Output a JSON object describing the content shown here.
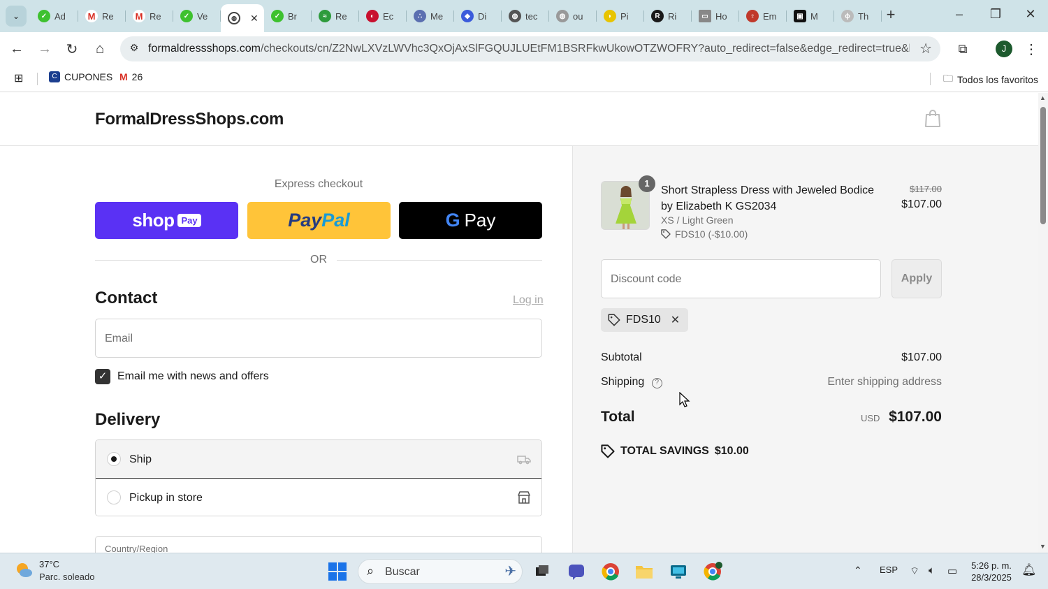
{
  "browser": {
    "tabs": [
      {
        "title": "Ad",
        "color": "#3ec12f"
      },
      {
        "title": "Re",
        "color": "#d93025"
      },
      {
        "title": "Re",
        "color": "#d93025"
      },
      {
        "title": "Ve",
        "color": "#3ec12f"
      },
      {
        "title": "",
        "color": "#555555",
        "active": true
      },
      {
        "title": "Br",
        "color": "#3ec12f"
      },
      {
        "title": "Re",
        "color": "#2e9b3c"
      },
      {
        "title": "Ec",
        "color": "#c8102e"
      },
      {
        "title": "Me",
        "color": "#5b6fb0"
      },
      {
        "title": "Di",
        "color": "#3b5bdb"
      },
      {
        "title": "tec",
        "color": "#555555"
      },
      {
        "title": "ou",
        "color": "#888888"
      },
      {
        "title": "Pi",
        "color": "#e8c400"
      },
      {
        "title": "Ri",
        "color": "#1a1a1a"
      },
      {
        "title": "Ho",
        "color": "#888888"
      },
      {
        "title": "Em",
        "color": "#c0392b"
      },
      {
        "title": "M",
        "color": "#111111"
      },
      {
        "title": "Th",
        "color": "#999999"
      }
    ],
    "url_domain": "formaldressshops.com",
    "url_path": "/checkouts/cn/Z2NwLXVzLWVhc3QxOjAxSlFGQUJLUEtFM1BSRFkwUkowOTZWOFRY?auto_redirect=false&edge_redirect=true&locale=e...",
    "bookmarks": {
      "cupones": "CUPONES",
      "gmail": "26",
      "favorites": "Todos los favoritos"
    },
    "profile_initial": "J"
  },
  "shop": {
    "logo": "FormalDressShops.com"
  },
  "checkout": {
    "express_title": "Express checkout",
    "shop_pay": {
      "shop": "shop",
      "pay": "Pay"
    },
    "paypal": {
      "pay": "Pay",
      "pal": "Pal"
    },
    "gpay": {
      "g": "G",
      "pay": "Pay"
    },
    "or": "OR",
    "contact_title": "Contact",
    "login": "Log in",
    "email_placeholder": "Email",
    "news_label": "Email me with news and offers",
    "delivery_title": "Delivery",
    "ship_label": "Ship",
    "pickup_label": "Pickup in store",
    "country_label": "Country/Region"
  },
  "summary": {
    "qty": "1",
    "product_name": "Short Strapless Dress with Jeweled Bodice by Elizabeth K GS2034",
    "variant": "XS / Light Green",
    "discount_line": "FDS10 (-$10.00)",
    "price_old": "$117.00",
    "price_new": "$107.00",
    "discount_placeholder": "Discount code",
    "apply": "Apply",
    "chip_code": "FDS10",
    "subtotal_label": "Subtotal",
    "subtotal_value": "$107.00",
    "shipping_label": "Shipping",
    "shipping_value": "Enter shipping address",
    "total_label": "Total",
    "total_currency": "USD",
    "total_value": "$107.00",
    "savings_label": "TOTAL SAVINGS",
    "savings_value": "$10.00"
  },
  "taskbar": {
    "temp": "37°C",
    "weather": "Parc. soleado",
    "search": "Buscar",
    "lang": "ESP",
    "time": "5:26 p. m.",
    "date": "28/3/2025"
  },
  "colors": {
    "shop_pay": "#5a31f4",
    "paypal": "#ffc439",
    "gpay": "#000000",
    "panel_bg": "#f5f5f5",
    "tabbar": "#cfe3e8"
  }
}
